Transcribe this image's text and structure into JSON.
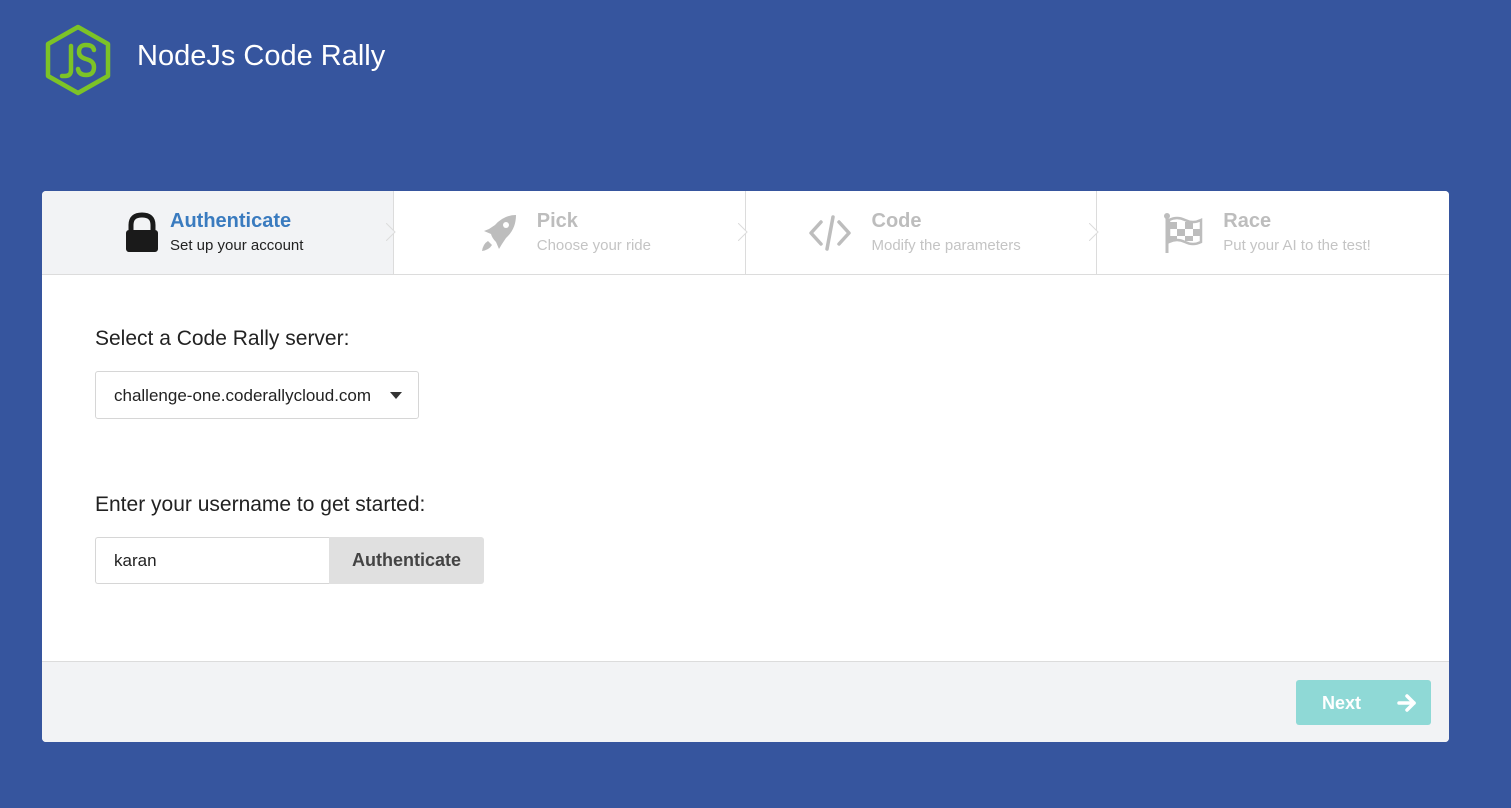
{
  "app": {
    "title": "NodeJs Code Rally",
    "logo_icon": "nodejs-hexagon-icon"
  },
  "steps": [
    {
      "title": "Authenticate",
      "subtitle": "Set up your account",
      "icon": "lock-icon",
      "active": true
    },
    {
      "title": "Pick",
      "subtitle": "Choose your ride",
      "icon": "rocket-icon",
      "active": false
    },
    {
      "title": "Code",
      "subtitle": "Modify the parameters",
      "icon": "code-icon",
      "active": false
    },
    {
      "title": "Race",
      "subtitle": "Put your AI to the test!",
      "icon": "checkered-flag-icon",
      "active": false
    }
  ],
  "server": {
    "label": "Select a Code Rally server:",
    "selected": "challenge-one.coderallycloud.com"
  },
  "username": {
    "label": "Enter your username to get started:",
    "value": "karan",
    "button_label": "Authenticate"
  },
  "footer": {
    "next_label": "Next"
  },
  "colors": {
    "background": "#36559e",
    "active_step_title": "#3a7bbf",
    "next_button": "#8fd9d6",
    "logo_green": "#7cc327"
  }
}
